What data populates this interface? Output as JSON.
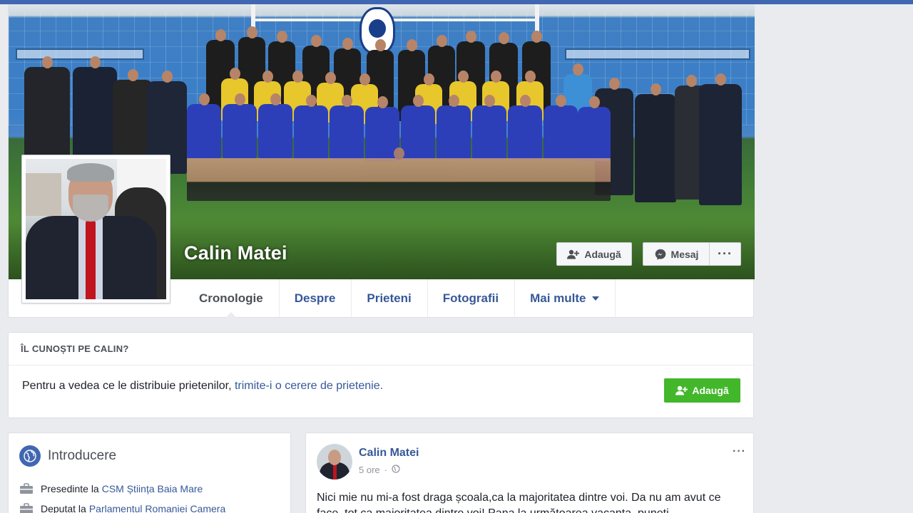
{
  "profile": {
    "name": "Calin Matei",
    "actions": {
      "add_friend": "Adaugă",
      "message": "Mesaj",
      "more": "···"
    }
  },
  "tabs": [
    {
      "label": "Cronologie",
      "active": true
    },
    {
      "label": "Despre",
      "active": false
    },
    {
      "label": "Prieteni",
      "active": false
    },
    {
      "label": "Fotografii",
      "active": false
    },
    {
      "label": "Mai multe",
      "active": false
    }
  ],
  "know_card": {
    "heading": "ÎL CUNOȘTI PE CALIN?",
    "text": "Pentru a vedea ce le distribuie prietenilor,",
    "link": "trimite-i o cerere de prietenie.",
    "button": "Adaugă"
  },
  "intro": {
    "title": "Introducere",
    "lines": [
      {
        "prefix": "Presedinte la",
        "link": "CSM Știința Baia Mare"
      },
      {
        "prefix": "Deputat la",
        "link": "Parlamentul Romaniei Camera"
      }
    ]
  },
  "post": {
    "author": "Calin Matei",
    "time": "5 ore",
    "audience_icon": "globe-icon",
    "more": "···",
    "text": "Nici mie nu mi-a fost draga școala,ca la majoritatea dintre voi. Da nu am avut ce face, tot ca majoritatea dintre voi! Pana la următoarea vacanta, puneti"
  },
  "colors": {
    "topbar": "#4267b2",
    "link": "#365899",
    "green_button": "#42b72a",
    "page_bg": "#e9ebee"
  }
}
